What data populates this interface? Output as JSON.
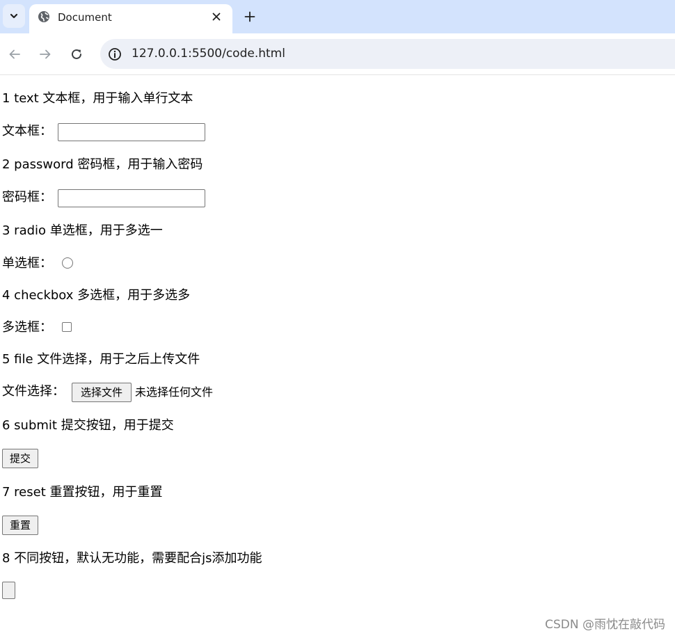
{
  "browser": {
    "tab_title": "Document",
    "url": "127.0.0.1:5500/code.html",
    "accent_color": "#d3e3fd"
  },
  "items": [
    {
      "heading": "1 text 文本框，用于输入单行文本",
      "label": "文本框："
    },
    {
      "heading": "2 password 密码框，用于输入密码",
      "label": "密码框："
    },
    {
      "heading": "3 radio 单选框，用于多选一",
      "label": "单选框："
    },
    {
      "heading": "4 checkbox 多选框，用于多选多",
      "label": "多选框："
    },
    {
      "heading": "5 file 文件选择，用于之后上传文件",
      "label": "文件选择：",
      "button": "选择文件",
      "status": "未选择任何文件"
    },
    {
      "heading": "6 submit 提交按钮，用于提交",
      "button": "提交"
    },
    {
      "heading": "7 reset 重置按钮，用于重置",
      "button": "重置"
    },
    {
      "heading": "8 不同按钮，默认无功能，需要配合js添加功能",
      "button": ""
    }
  ],
  "watermark": "CSDN @雨忱在敲代码"
}
